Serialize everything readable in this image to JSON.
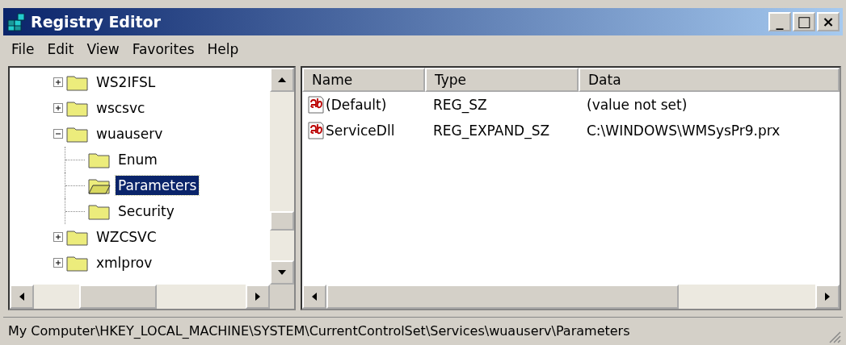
{
  "window": {
    "title": "Registry Editor",
    "controls": [
      "_",
      "□",
      "×"
    ]
  },
  "menu": [
    "File",
    "Edit",
    "View",
    "Favorites",
    "Help"
  ],
  "tree": {
    "items": [
      {
        "label": "WS2IFSL",
        "expanded": false,
        "selected": false
      },
      {
        "label": "wscsvc",
        "expanded": false,
        "selected": false
      },
      {
        "label": "wuauserv",
        "expanded": true,
        "selected": false,
        "children": [
          {
            "label": "Enum",
            "selected": false
          },
          {
            "label": "Parameters",
            "selected": true
          },
          {
            "label": "Security",
            "selected": false
          }
        ]
      },
      {
        "label": "WZCSVC",
        "expanded": false,
        "selected": false
      },
      {
        "label": "xmlprov",
        "expanded": false,
        "selected": false
      }
    ]
  },
  "values": {
    "columns": [
      "Name",
      "Type",
      "Data"
    ],
    "rows": [
      {
        "name": "(Default)",
        "type": "REG_SZ",
        "data": "(value not set)"
      },
      {
        "name": "ServiceDll",
        "type": "REG_EXPAND_SZ",
        "data": "C:\\WINDOWS\\WMSysPr9.prx"
      }
    ]
  },
  "status_bar": "My Computer\\HKEY_LOCAL_MACHINE\\SYSTEM\\CurrentControlSet\\Services\\wuauserv\\Parameters"
}
